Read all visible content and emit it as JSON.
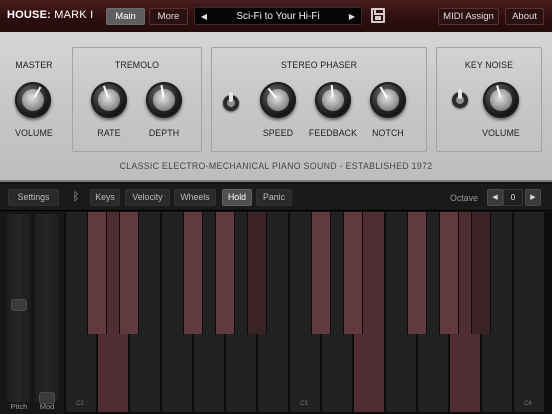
{
  "topbar": {
    "app_name": "HOUSE:",
    "app_model": "MARK I",
    "tabs": [
      {
        "label": "Main",
        "active": true
      },
      {
        "label": "More",
        "active": false
      }
    ],
    "preset": {
      "name": "Sci-Fi to Your Hi-Fi",
      "prev_icon": "triangle-left",
      "next_icon": "triangle-right"
    },
    "save_icon": "floppy-disk",
    "midi_assign_label": "MIDI Assign",
    "about_label": "About"
  },
  "panel": {
    "master": {
      "title": "MASTER",
      "knob_label": "VOLUME",
      "level": 0.5
    },
    "tremolo": {
      "title": "TREMOLO",
      "rate_label": "RATE",
      "depth_label": "DEPTH",
      "rate_level": 0.5,
      "depth_level": 0.5
    },
    "phaser": {
      "title": "STEREO PHASER",
      "speed_label": "SPEED",
      "feedback_label": "FEEDBACK",
      "notch_label": "NOTCH",
      "enabled": true
    },
    "key_noise": {
      "title": "KEY NOISE",
      "volume_label": "VOLUME",
      "enabled": true
    },
    "tagline": "CLASSIC ELECTRO-MECHANICAL PIANO SOUND - ESTABLISHED 1972"
  },
  "toolbar": {
    "settings_label": "Settings",
    "bluetooth_icon": "bluetooth",
    "keys_label": "Keys",
    "velocity_label": "Velocity",
    "wheels_label": "Wheels",
    "hold_label": "Hold",
    "hold_active": true,
    "panic_label": "Panic",
    "octave_label": "Octave",
    "octave_value": "0"
  },
  "wheels": {
    "pitch_label": "Pitch",
    "mod_label": "Mod"
  },
  "keyboard": {
    "key_labels": [
      "C2",
      "C3",
      "C4"
    ],
    "highlighted_white_keys": [
      1,
      9,
      12
    ],
    "highlighted_black_keys": [
      0,
      1,
      2,
      3,
      5,
      6,
      7,
      8,
      10,
      11
    ]
  },
  "colors": {
    "accent": "#4a1d1d",
    "key_highlight": "#603a3f"
  }
}
